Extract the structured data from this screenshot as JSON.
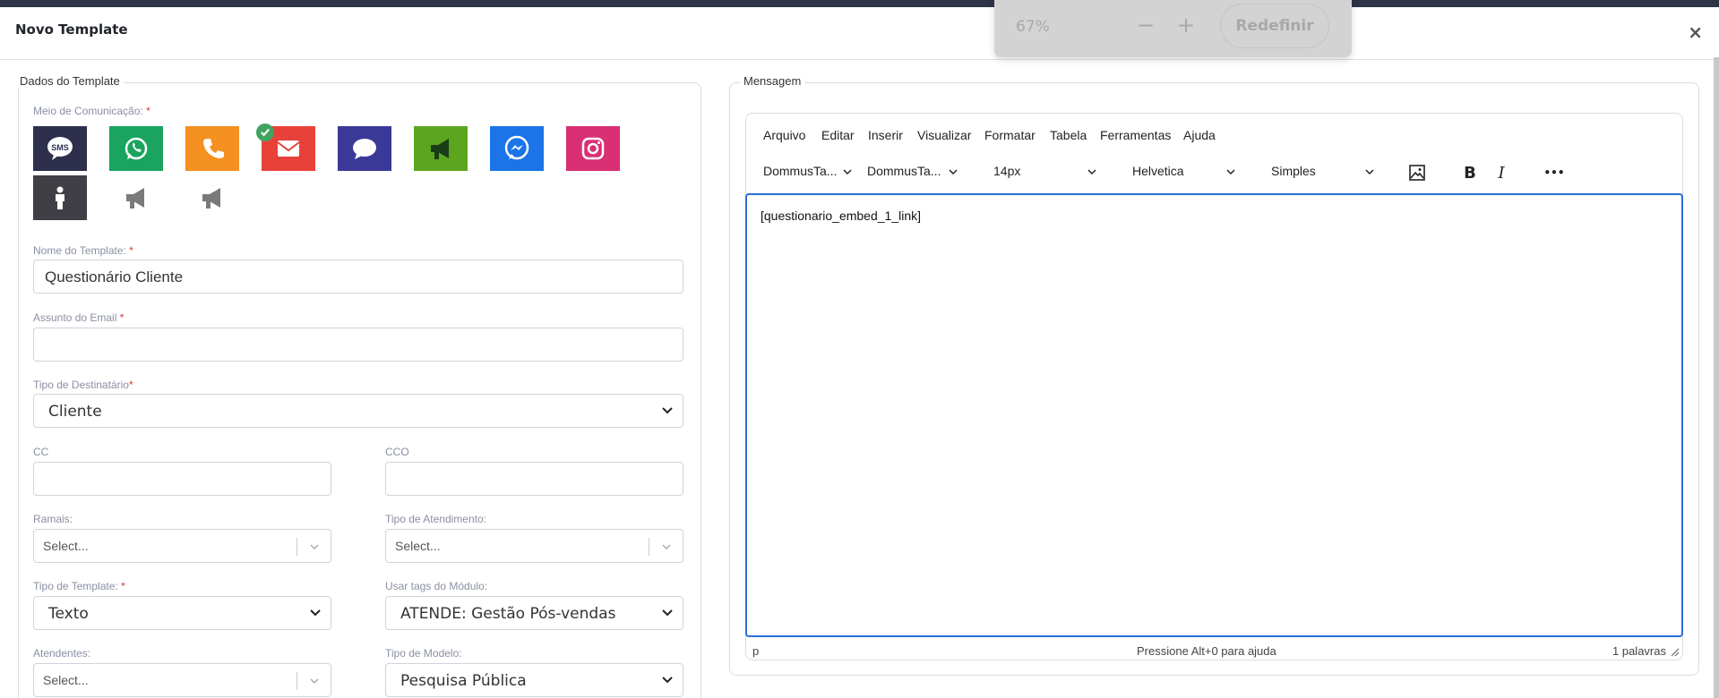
{
  "modal": {
    "title": "Novo Template",
    "close": "×"
  },
  "zoom": {
    "percent": "67%",
    "minus": "−",
    "plus": "+",
    "reset": "Redefinir"
  },
  "left": {
    "legend": "Dados do Template",
    "channels_label": "Meio de Comunicação:",
    "req": "*",
    "channels": [
      {
        "name": "sms",
        "color": "#2d2f4d"
      },
      {
        "name": "whatsapp",
        "color": "#1aa45f"
      },
      {
        "name": "phone",
        "color": "#f59120"
      },
      {
        "name": "email",
        "color": "#e8413a",
        "selected": true
      },
      {
        "name": "chat",
        "color": "#3b3998"
      },
      {
        "name": "megaphone",
        "color": "#5ba61e"
      },
      {
        "name": "messenger",
        "color": "#1b74e8"
      },
      {
        "name": "instagram",
        "color": "#d92f75"
      },
      {
        "name": "person",
        "color": "#3f3f45"
      },
      {
        "name": "megaphone-gray",
        "color": "#ffffff"
      },
      {
        "name": "megaphone-gray-2",
        "color": "#ffffff"
      }
    ],
    "template_name_label": "Nome do Template:",
    "template_name_value": "Questionário Cliente",
    "subject_label": "Assunto do Email",
    "subject_value": "",
    "dest_label": "Tipo de Destinatário",
    "dest_value": "Cliente",
    "cc_label": "CC",
    "cco_label": "CCO",
    "ramais_label": "Ramais:",
    "ramais_value": "Select...",
    "atendimento_label": "Tipo de Atendimento:",
    "atendimento_value": "Select...",
    "tipo_template_label": "Tipo de Template:",
    "tipo_template_value": "Texto",
    "tags_label": "Usar tags do Módulo:",
    "tags_value": "ATENDE: Gestão Pós-vendas",
    "atendentes_label": "Atendentes:",
    "atendentes_value": "Select...",
    "modelo_label": "Tipo de Modelo:",
    "modelo_value": "Pesquisa Pública"
  },
  "right": {
    "legend": "Mensagem",
    "menu": [
      "Arquivo",
      "Editar",
      "Inserir",
      "Visualizar",
      "Formatar",
      "Tabela",
      "Ferramentas",
      "Ajuda"
    ],
    "toolbar": {
      "dd1": "DommusTa...",
      "dd2": "DommusTa...",
      "size": "14px",
      "font": "Helvetica",
      "style": "Simples",
      "bold": "B",
      "italic": "I",
      "more": "•••"
    },
    "content": "[questionario_embed_1_link]",
    "status_path": "p",
    "status_help": "Pressione Alt+0 para ajuda",
    "status_words": "1 palavras"
  }
}
